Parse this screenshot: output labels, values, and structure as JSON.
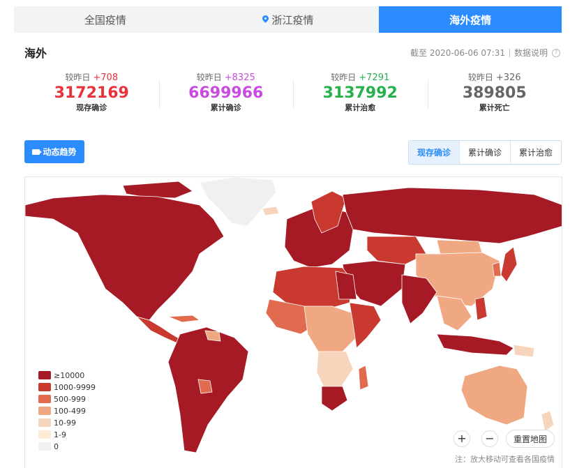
{
  "tabs": [
    {
      "label": "全国疫情",
      "active": false
    },
    {
      "label": "浙江疫情",
      "active": false,
      "icon": "location-pin-icon"
    },
    {
      "label": "海外疫情",
      "active": true
    }
  ],
  "header": {
    "title": "海外",
    "update_text": "截至 2020-06-06 07:31",
    "explain_label": "数据说明",
    "help_icon": "?"
  },
  "stats": [
    {
      "delta_prefix": "较昨日",
      "delta": "+708",
      "value": "3172169",
      "label": "现存确诊",
      "color": "#e8323c"
    },
    {
      "delta_prefix": "较昨日",
      "delta": "+8325",
      "value": "6699966",
      "label": "累计确诊",
      "color": "#c94be0"
    },
    {
      "delta_prefix": "较昨日",
      "delta": "+7291",
      "value": "3137992",
      "label": "累计治愈",
      "color": "#28b04d"
    },
    {
      "delta_prefix": "较昨日",
      "delta": "+326",
      "value": "389805",
      "label": "累计死亡",
      "color": "#666666"
    }
  ],
  "trend_button": {
    "label": "动态趋势",
    "icon": "video-camera-icon"
  },
  "view_toggle": [
    {
      "label": "现存确诊",
      "active": true
    },
    {
      "label": "累计确诊",
      "active": false
    },
    {
      "label": "累计治愈",
      "active": false
    }
  ],
  "legend": [
    {
      "label": "≥10000",
      "color": "#a51a25"
    },
    {
      "label": "1000-9999",
      "color": "#c9392f"
    },
    {
      "label": "500-999",
      "color": "#e06b4f"
    },
    {
      "label": "100-499",
      "color": "#f0a883"
    },
    {
      "label": "10-99",
      "color": "#f7d4bc"
    },
    {
      "label": "1-9",
      "color": "#fdebd5"
    },
    {
      "label": "0",
      "color": "#f0f0f0"
    }
  ],
  "map_controls": {
    "zoom_in": "+",
    "zoom_out": "−",
    "reset_label": "重置地图"
  },
  "map_note": "注：放大移动可查看各国疫情"
}
